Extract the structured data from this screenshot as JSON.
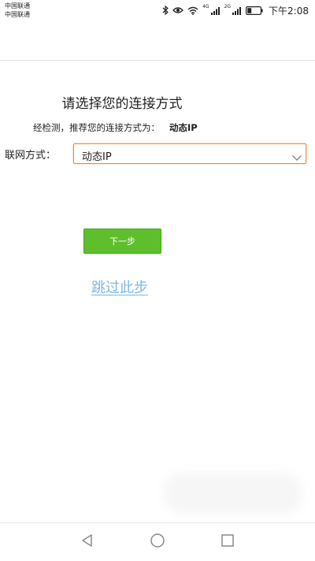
{
  "status_bar": {
    "carrier_1": "中国联通",
    "carrier_2": "中国联通",
    "network_1": "4G",
    "network_2": "2G",
    "time": "下午2:08",
    "icons": [
      "bluetooth-icon",
      "eye-icon",
      "wifi-icon",
      "signal-icon",
      "signal-icon",
      "battery-icon"
    ]
  },
  "page": {
    "title": "请选择您的连接方式",
    "detect_text": "经检测，推荐您的连接方式为：",
    "detect_value": "动态IP"
  },
  "form": {
    "label": "联网方式：",
    "selected": "动态IP"
  },
  "actions": {
    "next_label": "下一步",
    "skip_label": "跳过此步"
  },
  "nav_bar": {
    "icons": [
      "back-icon",
      "home-icon",
      "recent-apps-icon"
    ]
  },
  "colors": {
    "accent_green": "#5ebe2c",
    "focus_orange": "#f08a3a",
    "link_blue": "#7bb7e4"
  }
}
